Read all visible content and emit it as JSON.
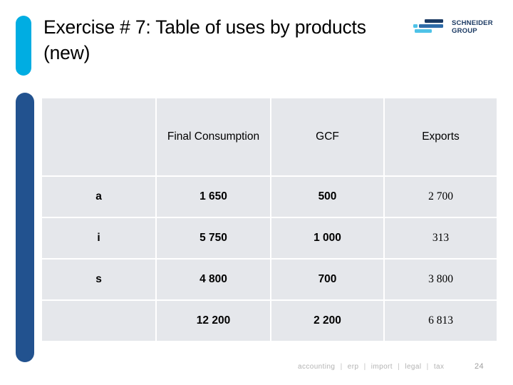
{
  "slide": {
    "title": "Exercise # 7: Table of uses by products (new)",
    "accent_cyan": "#00ADE2",
    "accent_navy": "#22528F",
    "cell_background": "#E5E7EB"
  },
  "logo": {
    "name": "schneider-group-logo",
    "line1": "SCHNEIDER",
    "line2": "GROUP",
    "mark_dark": "#1B3A63",
    "mark_light": "#4FC3E8"
  },
  "table": {
    "headers": [
      "",
      "Final Consumption",
      "GCF",
      "Exports"
    ],
    "rows": [
      {
        "label": "a",
        "final_consumption": "1 650",
        "gcf": "500",
        "exports": "2 700"
      },
      {
        "label": "i",
        "final_consumption": "5 750",
        "gcf": "1 000",
        "exports": "313"
      },
      {
        "label": "s",
        "final_consumption": "4 800",
        "gcf": "700",
        "exports": "3 800"
      },
      {
        "label": "",
        "final_consumption": "12 200",
        "gcf": "2 200",
        "exports": "6 813"
      }
    ]
  },
  "footer": {
    "items": [
      "accounting",
      "erp",
      "import",
      "legal",
      "tax"
    ],
    "separator": "|",
    "page_number": "24"
  }
}
